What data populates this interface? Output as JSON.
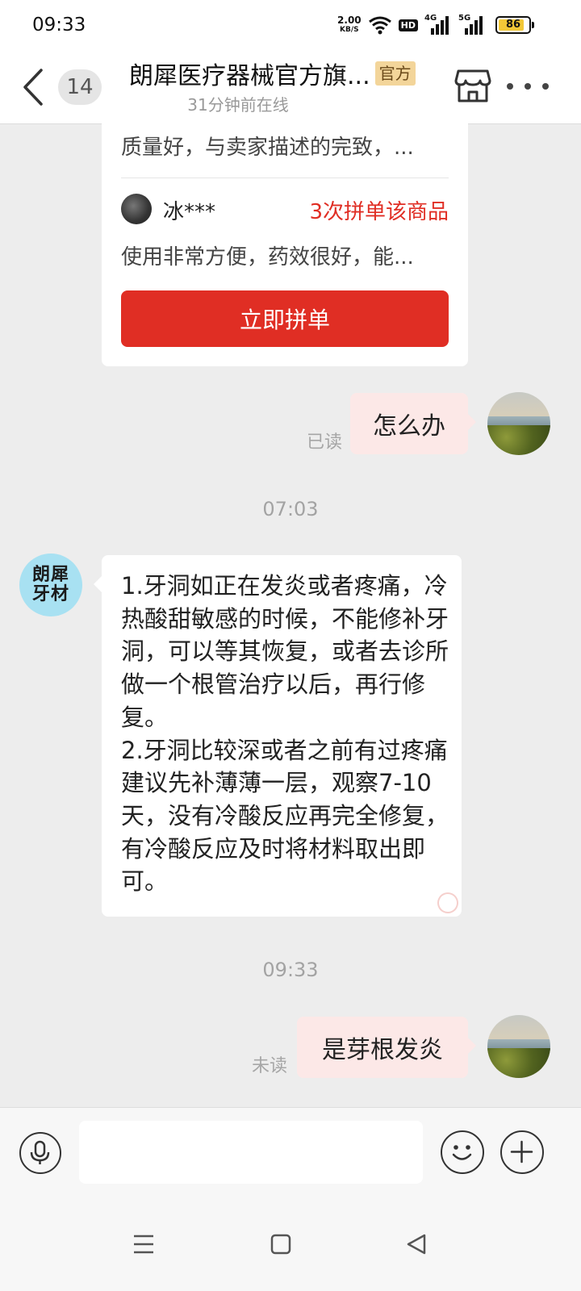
{
  "status_bar": {
    "time": "09:33",
    "net_speed": "2.00",
    "net_unit": "KB/S",
    "hd": "HD",
    "sim1": "4G",
    "sim2": "5G",
    "battery": "86",
    "battery_level": 0.86
  },
  "header": {
    "unread_count": "14",
    "shop_name": "朗犀医疗器械官方旗...",
    "official_badge": "官方",
    "online_status": "31分钟前在线"
  },
  "product_card": {
    "review1_text": "质量好，与卖家描述的完致，...",
    "reviewer_name": "冰***",
    "group_count": "3次拼单该商品",
    "review2_text": "使用非常方便，药效很好，能...",
    "buy_button": "立即拼单"
  },
  "messages": {
    "msg1": {
      "text": "怎么办",
      "status": "已读"
    },
    "timestamp1": "07:03",
    "shop_avatar_text": "朗犀\n牙材",
    "shop_reply": "1.牙洞如正在发炎或者疼痛，冷热酸甜敏感的时候，不能修补牙洞，可以等其恢复，或者去诊所做一个根管治疗以后，再行修复。\n2.牙洞比较深或者之前有过疼痛建议先补薄薄一层，观察7-10天，没有冷酸反应再完全修复，有冷酸反应及时将材料取出即可。",
    "timestamp2": "09:33",
    "msg2": {
      "text": "是芽根发炎",
      "status": "未读"
    }
  },
  "input_bar": {
    "value": "",
    "placeholder": ""
  },
  "colors": {
    "accent_red": "#e02e24",
    "outgoing_bubble": "#fce8e7",
    "incoming_bubble": "#ffffff",
    "chat_background": "#ededed",
    "official_badge_bg": "#f3d59a"
  },
  "icons": [
    "back-icon",
    "store-icon",
    "more-icon",
    "microphone-icon",
    "emoji-icon",
    "plus-icon",
    "menu-icon",
    "home-icon",
    "back-triangle-icon"
  ]
}
